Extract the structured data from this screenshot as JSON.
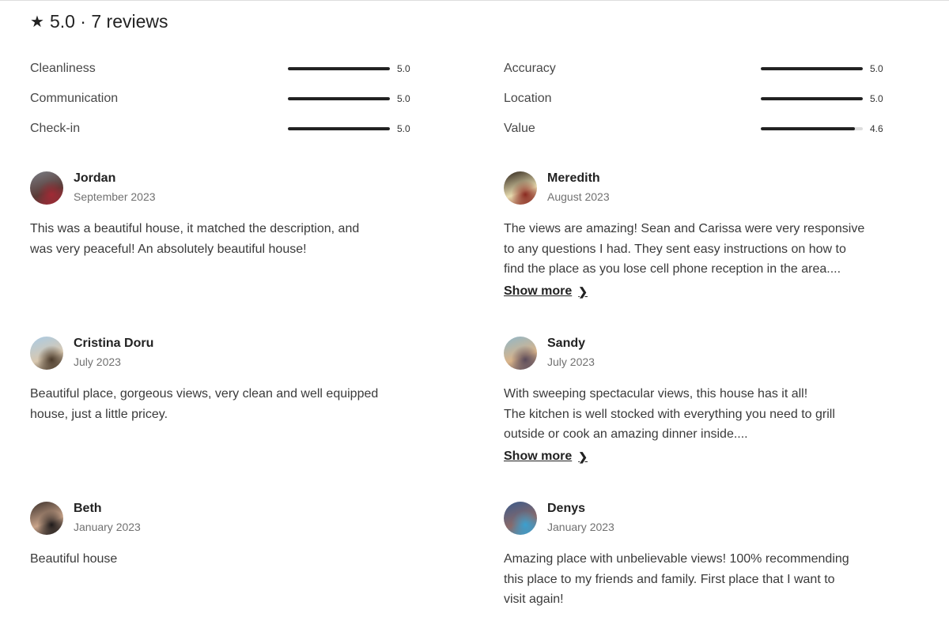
{
  "header": {
    "star_icon": "★",
    "summary": "5.0 · 7 reviews"
  },
  "ratings": [
    {
      "label": "Cleanliness",
      "value": "5.0",
      "fraction": 1.0
    },
    {
      "label": "Communication",
      "value": "5.0",
      "fraction": 1.0
    },
    {
      "label": "Check-in",
      "value": "5.0",
      "fraction": 1.0
    },
    {
      "label": "Accuracy",
      "value": "5.0",
      "fraction": 1.0
    },
    {
      "label": "Location",
      "value": "5.0",
      "fraction": 1.0
    },
    {
      "label": "Value",
      "value": "4.6",
      "fraction": 0.92
    }
  ],
  "reviews": [
    {
      "name": "Jordan",
      "date": "September 2023",
      "text": "This was a beautiful house, it matched the description, and\nwas very peaceful! An absolutely beautiful house!",
      "avatar_colors": [
        "#7a7f86",
        "#5a3a36",
        "#a02a35"
      ]
    },
    {
      "name": "Meredith",
      "date": "August 2023",
      "text": "The views are amazing! Sean and Carissa were very responsive\nto any questions I had. They sent easy instructions on how to\nfind the place as you lose cell phone reception in the area....",
      "show_more": "Show more",
      "avatar_colors": [
        "#2b2118",
        "#e8dcb0",
        "#8a2a20"
      ]
    },
    {
      "name": "Cristina Doru",
      "date": "July 2023",
      "text": "Beautiful place, gorgeous views, very clean and well equipped\nhouse, just a little pricey.",
      "avatar_colors": [
        "#a9cbe6",
        "#d8c8b0",
        "#4a3a2a"
      ]
    },
    {
      "name": "Sandy",
      "date": "July 2023",
      "text": "With sweeping spectacular views, this house has it all!\nThe kitchen is well stocked with everything you need to grill\noutside or cook an amazing dinner inside....",
      "show_more": "Show more",
      "avatar_colors": [
        "#8fb7c9",
        "#d9b48a",
        "#5a4a5a"
      ]
    },
    {
      "name": "Beth",
      "date": "January 2023",
      "text": "Beautiful house",
      "avatar_colors": [
        "#3a2f2a",
        "#c9a48a",
        "#1e1a1a"
      ]
    },
    {
      "name": "Denys",
      "date": "January 2023",
      "text": "Amazing place with unbelievable views! 100% recommending\nthis place to my friends and family. First place that I want to\nvisit again!",
      "avatar_colors": [
        "#3a5a8a",
        "#8a6a6a",
        "#3aa0d0"
      ]
    }
  ],
  "chevron_icon": "❯"
}
